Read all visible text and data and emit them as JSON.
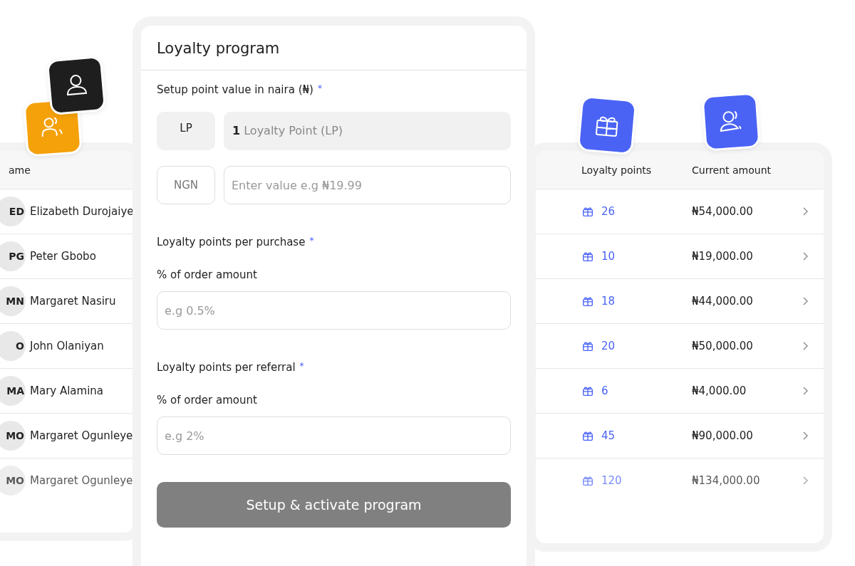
{
  "customers_table": {
    "columns": [
      "ame"
    ],
    "rows": [
      {
        "initials": "ED",
        "name": "Elizabeth Durojaiye",
        "blurred": false
      },
      {
        "initials": "PG",
        "name": "Peter Gbobo",
        "blurred": false
      },
      {
        "initials": "MN",
        "name": "Margaret Nasiru",
        "blurred": false
      },
      {
        "initials": "O",
        "name": "John Olaniyan",
        "blurred": false
      },
      {
        "initials": "MA",
        "name": "Mary Alamina",
        "blurred": false
      },
      {
        "initials": "MO",
        "name": "Margaret Ogunleye",
        "blurred": false
      },
      {
        "initials": "MO",
        "name": "Margaret Ogunleye",
        "blurred": true
      }
    ]
  },
  "points_table": {
    "columns": [
      "Loyalty points",
      "Current amount"
    ],
    "rows": [
      {
        "points": "26",
        "amount": "₦54,000.00",
        "blurred": false
      },
      {
        "points": "10",
        "amount": "₦19,000.00",
        "blurred": false
      },
      {
        "points": "18",
        "amount": "₦44,000.00",
        "blurred": false
      },
      {
        "points": "20",
        "amount": "₦50,000.00",
        "blurred": false
      },
      {
        "points": "6",
        "amount": "₦4,000.00",
        "blurred": false
      },
      {
        "points": "45",
        "amount": "₦90,000.00",
        "blurred": false
      },
      {
        "points": "120",
        "amount": "₦134,000.00",
        "blurred": true
      }
    ]
  },
  "modal": {
    "title": "Loyalty program",
    "point_value": {
      "label": "Setup point value in naira (₦)",
      "required_mark": "*",
      "rows": [
        {
          "kind": "readonly",
          "prefix": "LP",
          "value": "**1** Loyalty Point (LP)"
        },
        {
          "kind": "input",
          "prefix": "NGN",
          "placeholder": "Enter value e.g ₦19.99"
        }
      ]
    },
    "sections": [
      {
        "label": "Loyalty points per purchase",
        "required_mark": "*",
        "sublabel": "% of order amount",
        "placeholder": "e.g 0.5%"
      },
      {
        "label": "Loyalty points per referral",
        "required_mark": "*",
        "sublabel": "% of order amount",
        "placeholder": "e.g 2%"
      }
    ],
    "button": {
      "label": "Setup & activate program",
      "disabled": true
    }
  }
}
